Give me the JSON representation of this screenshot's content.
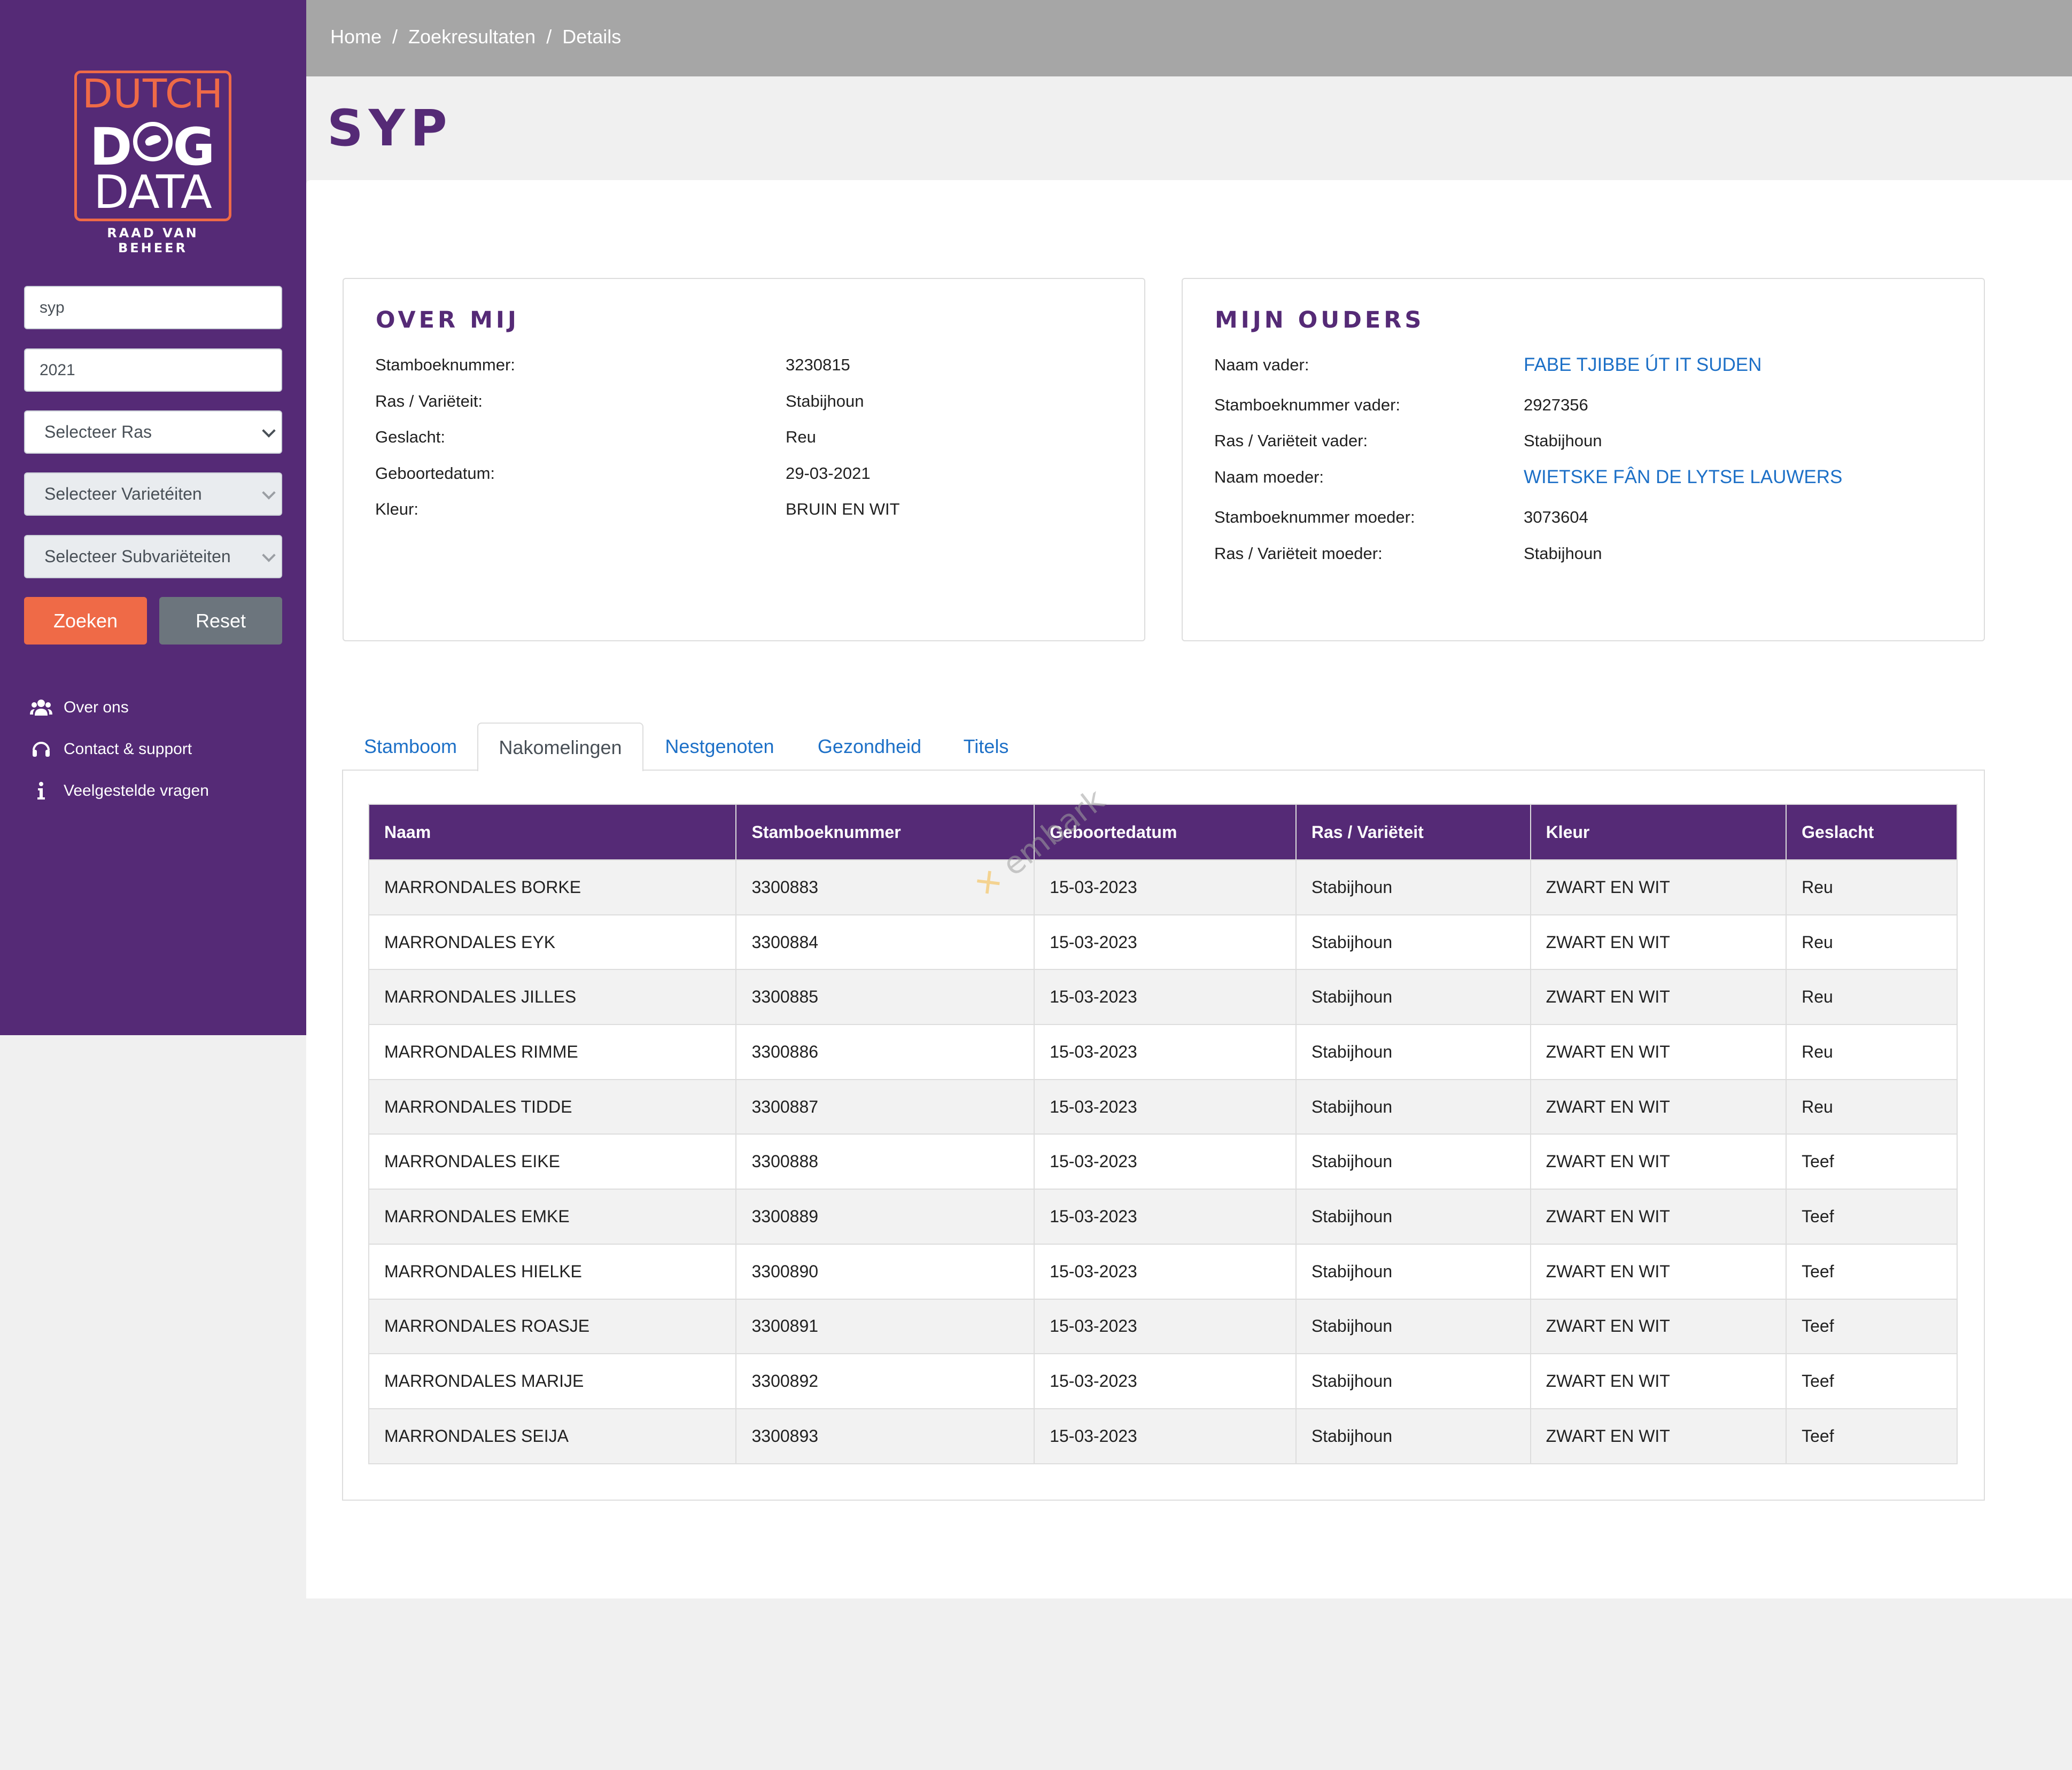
{
  "brand": {
    "line1": "DUTCH",
    "line2a": "D",
    "line2b": "G",
    "line3": "DATA",
    "subtitle": "RAAD VAN BEHEER"
  },
  "sidebar": {
    "search_value": "syp",
    "year_value": "2021",
    "select_ras": "Selecteer Ras",
    "select_varieteiten": "Selecteer Varietéiten",
    "select_subvarieteiten": "Selecteer Subvariëteiten",
    "search_button": "Zoeken",
    "reset_button": "Reset",
    "links": [
      {
        "label": "Over ons",
        "icon": "users-icon"
      },
      {
        "label": "Contact & support",
        "icon": "headset-icon"
      },
      {
        "label": "Veelgestelde vragen",
        "icon": "info-icon"
      }
    ]
  },
  "breadcrumb": {
    "items": [
      "Home",
      "Zoekresultaten",
      "Details"
    ],
    "separator": "/"
  },
  "page": {
    "title": "SYP"
  },
  "over_mij": {
    "title": "OVER MIJ",
    "rows": [
      {
        "label": "Stamboeknummer:",
        "value": "3230815"
      },
      {
        "label": "Ras / Variëteit:",
        "value": "Stabijhoun"
      },
      {
        "label": "Geslacht:",
        "value": "Reu"
      },
      {
        "label": "Geboortedatum:",
        "value": "29-03-2021"
      },
      {
        "label": "Kleur:",
        "value": "BRUIN EN WIT"
      }
    ]
  },
  "mijn_ouders": {
    "title": "MIJN OUDERS",
    "rows": [
      {
        "label": "Naam vader:",
        "value": "FABE TJIBBE ÚT IT SUDEN"
      },
      {
        "label": "Stamboeknummer vader:",
        "value": "2927356"
      },
      {
        "label": "Ras / Variëteit vader:",
        "value": "Stabijhoun"
      },
      {
        "label": "Naam moeder:",
        "value": "WIETSKE FÂN DE LYTSE LAUWERS"
      },
      {
        "label": "Stamboeknummer moeder:",
        "value": "3073604"
      },
      {
        "label": "Ras / Variëteit moeder:",
        "value": "Stabijhoun"
      }
    ]
  },
  "tabs": [
    "Stamboom",
    "Nakomelingen",
    "Nestgenoten",
    "Gezondheid",
    "Titels"
  ],
  "active_tab": "Nakomelingen",
  "table": {
    "headers": [
      "Naam",
      "Stamboeknummer",
      "Geboortedatum",
      "Ras / Variëteit",
      "Kleur",
      "Geslacht"
    ],
    "rows": [
      [
        "MARRONDALES BORKE",
        "3300883",
        "15-03-2023",
        "Stabijhoun",
        "ZWART EN WIT",
        "Reu"
      ],
      [
        "MARRONDALES EYK",
        "3300884",
        "15-03-2023",
        "Stabijhoun",
        "ZWART EN WIT",
        "Reu"
      ],
      [
        "MARRONDALES JILLES",
        "3300885",
        "15-03-2023",
        "Stabijhoun",
        "ZWART EN WIT",
        "Reu"
      ],
      [
        "MARRONDALES RIMME",
        "3300886",
        "15-03-2023",
        "Stabijhoun",
        "ZWART EN WIT",
        "Reu"
      ],
      [
        "MARRONDALES TIDDE",
        "3300887",
        "15-03-2023",
        "Stabijhoun",
        "ZWART EN WIT",
        "Reu"
      ],
      [
        "MARRONDALES EIKE",
        "3300888",
        "15-03-2023",
        "Stabijhoun",
        "ZWART EN WIT",
        "Teef"
      ],
      [
        "MARRONDALES EMKE",
        "3300889",
        "15-03-2023",
        "Stabijhoun",
        "ZWART EN WIT",
        "Teef"
      ],
      [
        "MARRONDALES HIELKE",
        "3300890",
        "15-03-2023",
        "Stabijhoun",
        "ZWART EN WIT",
        "Teef"
      ],
      [
        "MARRONDALES ROASJE",
        "3300891",
        "15-03-2023",
        "Stabijhoun",
        "ZWART EN WIT",
        "Teef"
      ],
      [
        "MARRONDALES MARIJE",
        "3300892",
        "15-03-2023",
        "Stabijhoun",
        "ZWART EN WIT",
        "Teef"
      ],
      [
        "MARRONDALES SEIJA",
        "3300893",
        "15-03-2023",
        "Stabijhoun",
        "ZWART EN WIT",
        "Teef"
      ]
    ]
  },
  "watermark": "embark",
  "colors": {
    "brand_purple": "#552a76",
    "accent_orange": "#ef6a47",
    "link_blue": "#1d70c7",
    "topbar_gray": "#a6a6a6"
  }
}
